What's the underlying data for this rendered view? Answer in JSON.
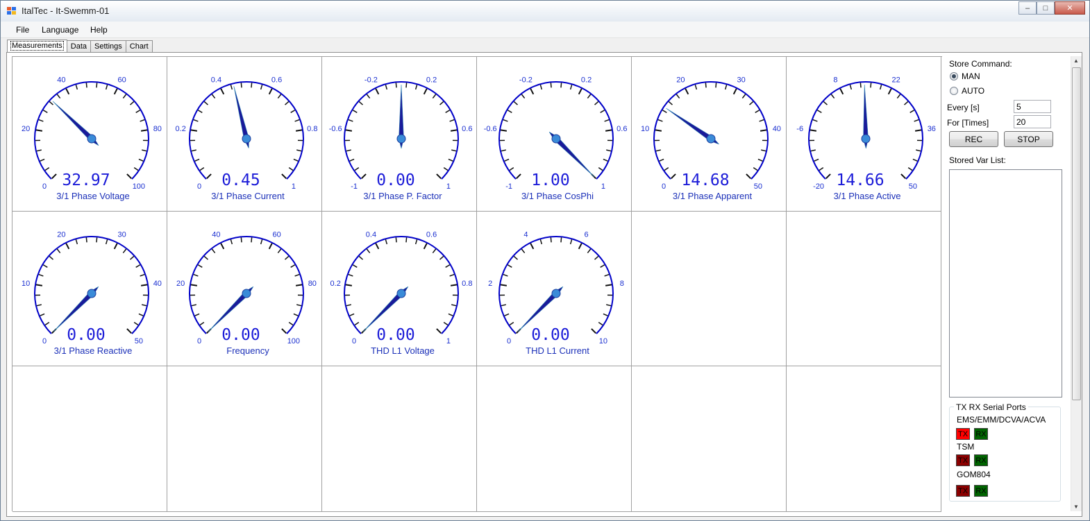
{
  "window": {
    "title": "ItalTec - It-Swemm-01",
    "minimize_icon": "minimize-icon",
    "maximize_icon": "maximize-icon",
    "close_icon": "close-icon"
  },
  "menu": [
    "File",
    "Language",
    "Help"
  ],
  "tabs": [
    {
      "label": "Measurements",
      "active": true
    },
    {
      "label": "Data",
      "active": false
    },
    {
      "label": "Settings",
      "active": false
    },
    {
      "label": "Chart",
      "active": false
    }
  ],
  "gauges": [
    {
      "title": "3/1 Phase Voltage",
      "min": 0,
      "max": 100,
      "value": 32.97,
      "display": "32.97",
      "labels": [
        "0",
        "20",
        "40",
        "60",
        "80",
        "100"
      ]
    },
    {
      "title": "3/1 Phase Current",
      "min": 0,
      "max": 1,
      "value": 0.45,
      "display": "0.45",
      "labels": [
        "0",
        "0.2",
        "0.4",
        "0.6",
        "0.8",
        "1"
      ]
    },
    {
      "title": "3/1 Phase P. Factor",
      "min": -1,
      "max": 1,
      "value": 0.0,
      "display": "0.00",
      "labels": [
        "-1",
        "-0.6",
        "-0.2",
        "0.2",
        "0.6",
        "1"
      ]
    },
    {
      "title": "3/1 Phase CosPhi",
      "min": -1,
      "max": 1,
      "value": 1.0,
      "display": "1.00",
      "labels": [
        "-1",
        "-0.6",
        "-0.2",
        "0.2",
        "0.6",
        "1"
      ]
    },
    {
      "title": "3/1 Phase Apparent",
      "min": 0,
      "max": 50,
      "value": 14.68,
      "display": "14.68",
      "labels": [
        "0",
        "10",
        "20",
        "30",
        "40",
        "50"
      ]
    },
    {
      "title": "3/1 Phase Active",
      "min": -20,
      "max": 50,
      "value": 14.66,
      "display": "14.66",
      "labels": [
        "-20",
        "-6",
        "8",
        "22",
        "36",
        "50"
      ]
    },
    {
      "title": "3/1 Phase Reactive",
      "min": 0,
      "max": 50,
      "value": 0.0,
      "display": "0.00",
      "labels": [
        "0",
        "10",
        "20",
        "30",
        "40",
        "50"
      ]
    },
    {
      "title": "Frequency",
      "min": 0,
      "max": 100,
      "value": 0.0,
      "display": "0.00",
      "labels": [
        "0",
        "20",
        "40",
        "60",
        "80",
        "100"
      ]
    },
    {
      "title": "THD L1 Voltage",
      "min": 0,
      "max": 1,
      "value": 0.0,
      "display": "0.00",
      "labels": [
        "0",
        "0.2",
        "0.4",
        "0.6",
        "0.8",
        "1"
      ]
    },
    {
      "title": "THD L1 Current",
      "min": 0,
      "max": 10,
      "value": 0.0,
      "display": "0.00",
      "labels": [
        "0",
        "2",
        "4",
        "6",
        "8",
        "10"
      ]
    }
  ],
  "side": {
    "store_command_label": "Store Command:",
    "radio_man": "MAN",
    "radio_auto": "AUTO",
    "selected_mode": "MAN",
    "every_label": "Every [s]",
    "every_value": "5",
    "for_label": "For [Times]",
    "for_value": "20",
    "rec_label": "REC",
    "stop_label": "STOP",
    "stored_var_label": "Stored Var List:",
    "serial_group_title": "TX RX Serial Ports",
    "ports": [
      {
        "name": "EMS/EMM/DCVA/ACVA",
        "tx_color": "#ff0000",
        "rx_color": "#006400"
      },
      {
        "name": "TSM",
        "tx_color": "#8b0000",
        "rx_color": "#006400"
      },
      {
        "name": "GOM804",
        "tx_color": "#8b0000",
        "rx_color": "#006400"
      }
    ],
    "tx_label": "TX",
    "rx_label": "RX"
  },
  "colors": {
    "gauge_blue": "#0000c8",
    "needle": "#1a1a9a",
    "hub": "#3a8bd8",
    "scale_text": "#1a2fd0"
  }
}
